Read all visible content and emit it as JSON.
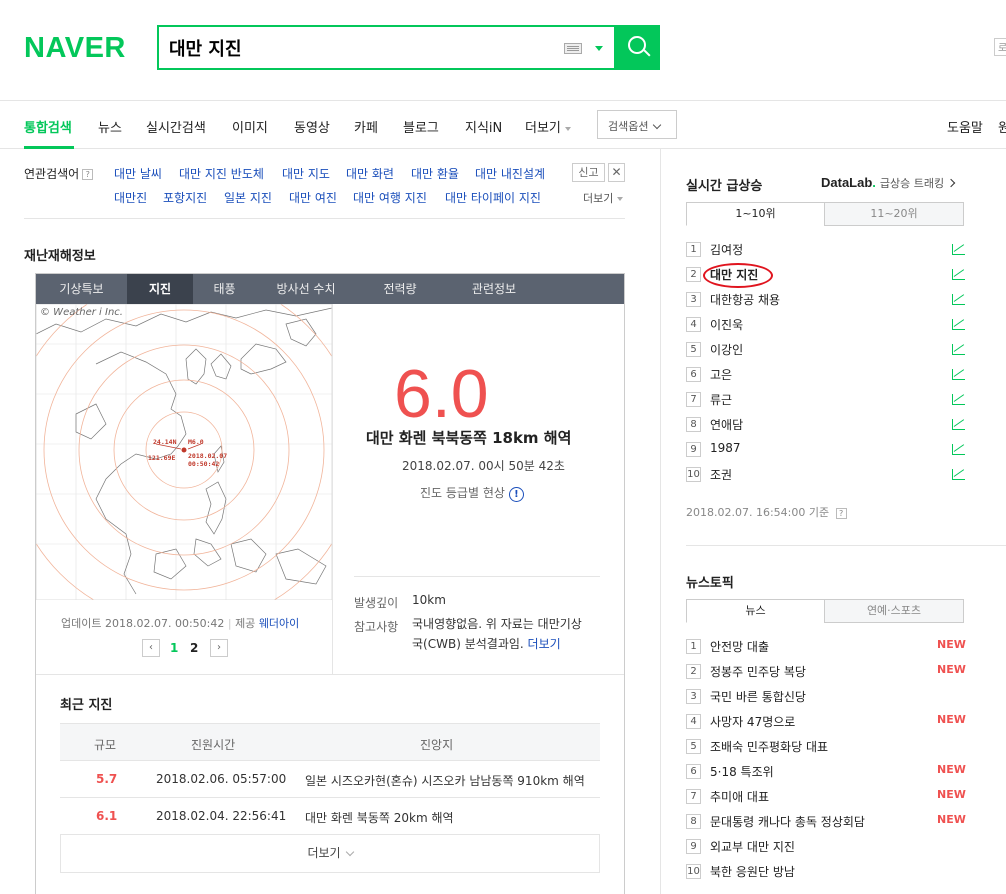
{
  "header": {
    "logo": "NAVER",
    "search_value": "대만 지진",
    "edge_label": "로"
  },
  "nav": {
    "items": [
      "통합검색",
      "뉴스",
      "실시간검색",
      "이미지",
      "동영상",
      "카페",
      "블로그",
      "지식iN",
      "더보기"
    ],
    "search_options": "검색옵션",
    "help": "도움말",
    "edge": "원"
  },
  "related": {
    "label": "연관검색어",
    "row1": [
      "대만 날씨",
      "대만 지진 반도체",
      "대만 지도",
      "대만 화련",
      "대만 환율",
      "대만 내진설계"
    ],
    "row2": [
      "대만진",
      "포항지진",
      "일본 지진",
      "대만 여진",
      "대만 여행 지진",
      "대만 타이페이 지진"
    ],
    "report": "신고",
    "close": "✕",
    "more": "더보기"
  },
  "disaster": {
    "title": "재난재해정보",
    "tabs": [
      "기상특보",
      "지진",
      "태풍",
      "방사선 수치",
      "전력량",
      "관련정보"
    ],
    "copyright": "© Weather i Inc.",
    "map_label_lat": "24.14N",
    "map_label_mag": "M6.0",
    "map_label_lon": "121.69E",
    "map_label_date": "2018.02.07",
    "map_label_time": "00:50:42",
    "update_label": "업데이트 2018.02.07. 00:50:42",
    "provider_label": "제공",
    "provider": "웨더아이",
    "pages": [
      "1",
      "2"
    ],
    "magnitude": "6.0",
    "location": "대만 화렌 북북동쪽 18km 해역",
    "time": "2018.02.07. 00시 50분 42초",
    "intensity": "진도 등급별 현상",
    "depth_label": "발생깊이",
    "depth_value": "10km",
    "note_label": "참고사항",
    "note_line1": "국내영향없음. 위 자료는 대만기상",
    "note_line2": "국(CWB) 분석결과임.",
    "note_more": "더보기",
    "recent_title": "최근 지진",
    "table_headers": [
      "규모",
      "진원시간",
      "진앙지"
    ],
    "recent": [
      {
        "mag": "5.7",
        "time": "2018.02.06. 05:57:00",
        "place": "일본 시즈오카현(혼슈) 시즈오카 남남동쪽 910km 해역"
      },
      {
        "mag": "6.1",
        "time": "2018.02.04. 22:56:41",
        "place": "대만 화렌 북동쪽 20km 해역"
      }
    ],
    "more": "더보기"
  },
  "realtime": {
    "title": "실시간 급상승",
    "datalab": "DataLab",
    "datalab_dot": ".",
    "datalab_trend": "급상승 트래킹",
    "tabs": [
      "1~10위",
      "11~20위"
    ],
    "items": [
      "김여정",
      "대만 지진",
      "대한항공 채용",
      "이진욱",
      "이강인",
      "고은",
      "류근",
      "연애담",
      "1987",
      "조권"
    ],
    "timestamp": "2018.02.07. 16:54:00 기준"
  },
  "news_topic": {
    "title": "뉴스토픽",
    "tabs": [
      "뉴스",
      "연예·스포츠"
    ],
    "items": [
      {
        "text": "안전망 대출",
        "new": "NEW"
      },
      {
        "text": "정봉주 민주당 복당",
        "new": "NEW"
      },
      {
        "text": "국민 바른 통합신당",
        "new": ""
      },
      {
        "text": "사망자 47명으로",
        "new": "NEW"
      },
      {
        "text": "조배숙 민주평화당 대표",
        "new": ""
      },
      {
        "text": "5·18 특조위",
        "new": "NEW"
      },
      {
        "text": "추미애 대표",
        "new": "NEW"
      },
      {
        "text": "문대통령 캐나다 총독 정상회담",
        "new": "NEW"
      },
      {
        "text": "외교부 대만 지진",
        "new": ""
      },
      {
        "text": "북한 응원단 방남",
        "new": ""
      }
    ]
  },
  "colors": {
    "brand": "#03c75a",
    "magnitude": "#ef5150",
    "link": "#1b4fbb",
    "highlight": "#e0141e"
  }
}
